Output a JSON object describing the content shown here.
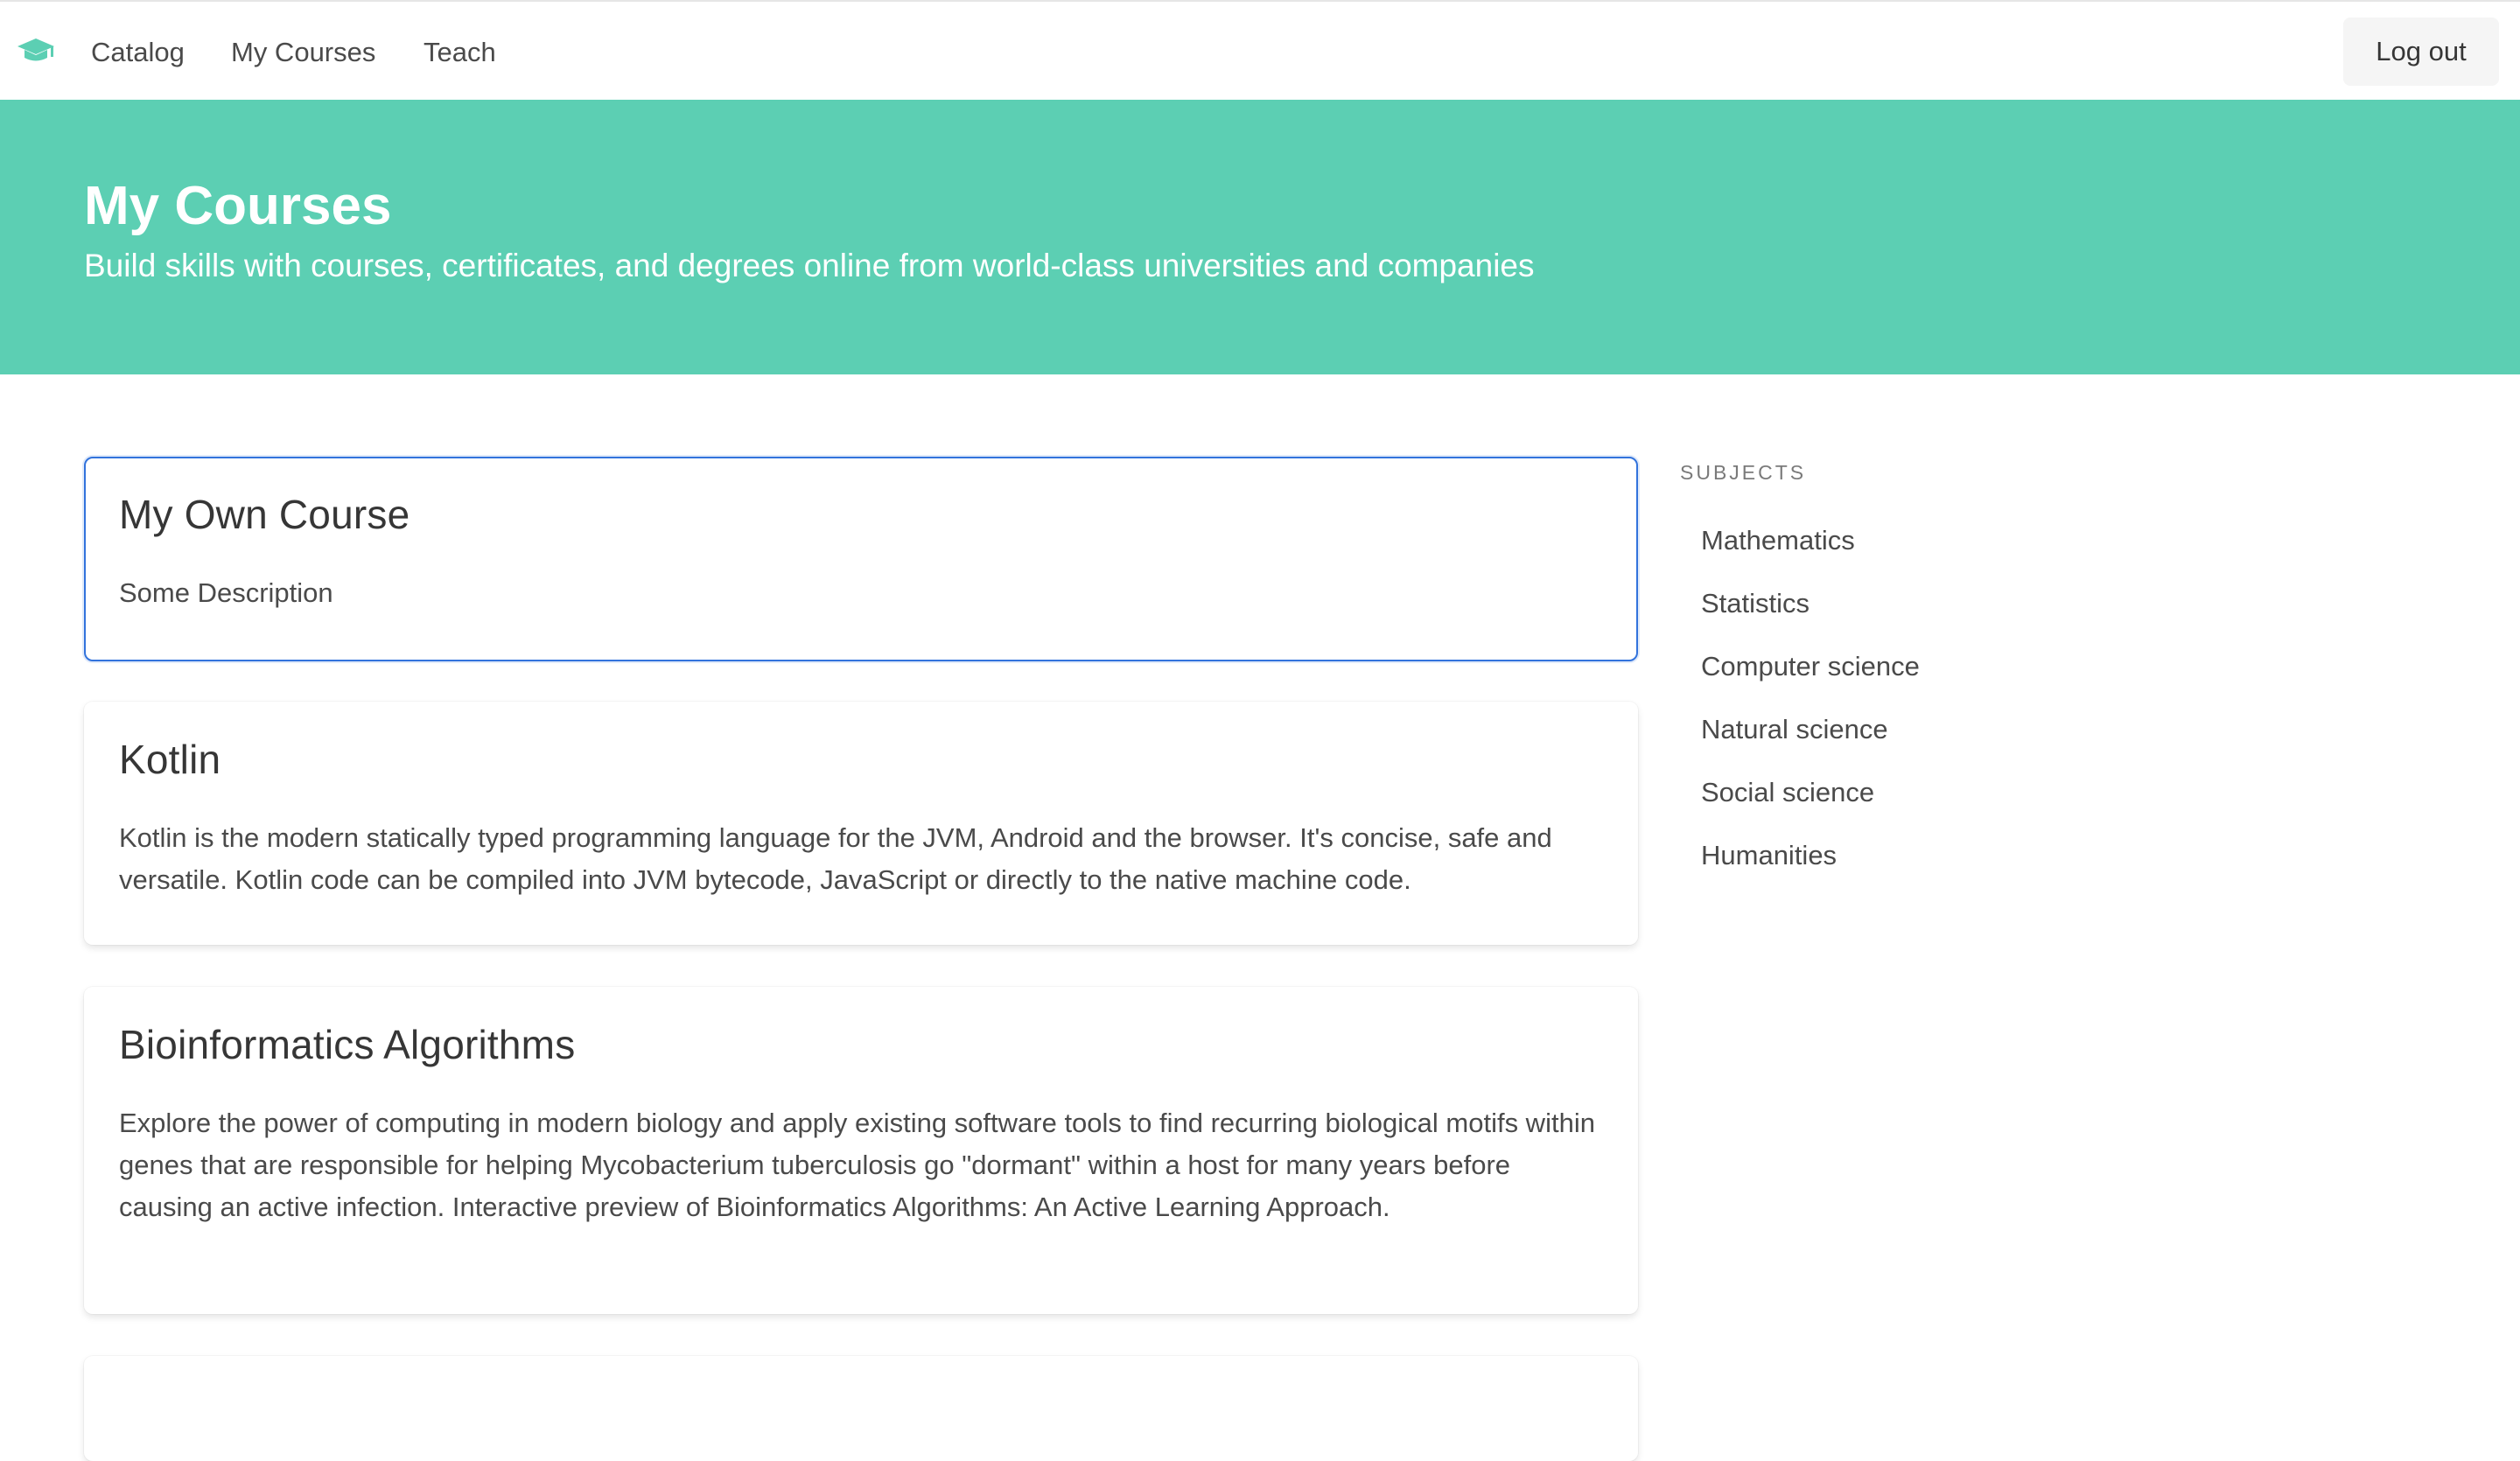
{
  "nav": {
    "logo_icon": "graduation-cap-icon",
    "brand_color": "#5ccfb3",
    "links": [
      "Catalog",
      "My Courses",
      "Teach"
    ],
    "logout_label": "Log out"
  },
  "hero": {
    "title": "My Courses",
    "subtitle": "Build skills with courses, certificates, and degrees online from world-class universities and companies",
    "background_color": "#5ccfb3"
  },
  "courses": [
    {
      "title": "My Own Course",
      "description": "Some Description",
      "selected": true
    },
    {
      "title": "Kotlin",
      "description": "Kotlin is the modern statically typed programming language for the JVM, Android and the browser. It's concise, safe and versatile. Kotlin code can be compiled into JVM bytecode, JavaScript or directly to the native machine code."
    },
    {
      "title": "Bioinformatics Algorithms",
      "description": "Explore the power of computing in modern biology and apply existing software tools to find recurring biological motifs within genes that are responsible for helping Mycobacterium tuberculosis go \"dormant\" within a host for many years before causing an active infection. Interactive preview of Bioinformatics Algorithms: An Active Learning Approach."
    }
  ],
  "sidebar": {
    "label": "SUBJECTS",
    "items": [
      "Mathematics",
      "Statistics",
      "Computer science",
      "Natural science",
      "Social science",
      "Humanities"
    ]
  }
}
